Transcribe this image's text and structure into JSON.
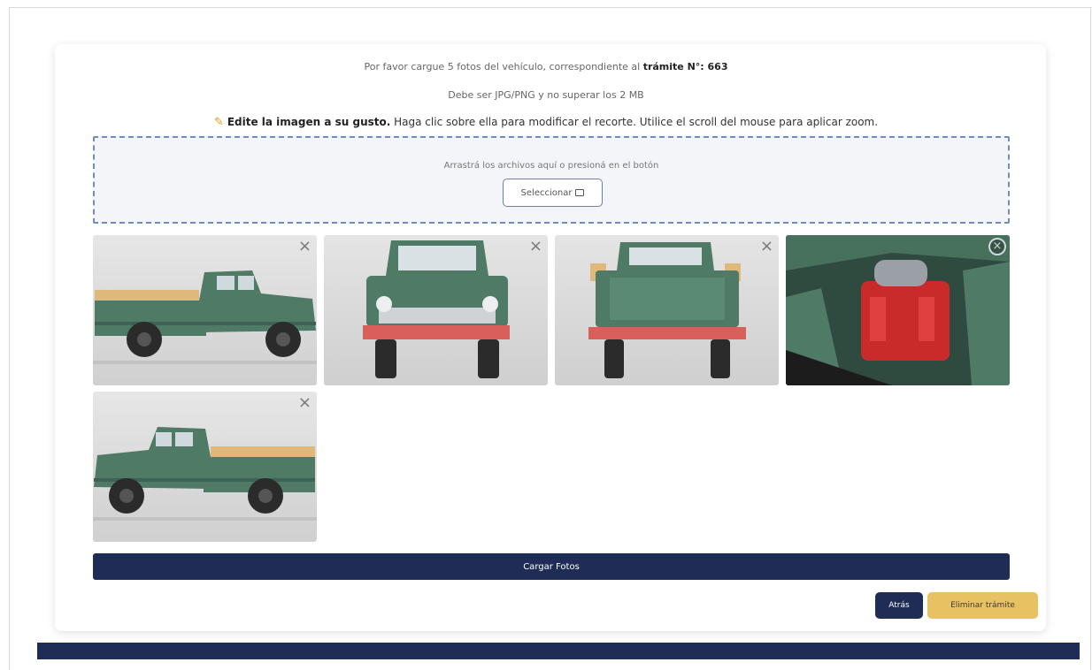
{
  "instructions": {
    "line1_prefix": "Por favor cargue 5 fotos del vehículo, correspondiente al",
    "line1_bold": "trámite N°: 663",
    "line2": "Debe ser JPG/PNG y no superar los 2 MB",
    "line3_bold": "Edite la imagen a su gusto.",
    "line3_rest": "Haga clic sobre ella para modificar el recorte. Utilice el scroll del mouse para aplicar zoom."
  },
  "dropzone": {
    "text": "Arrastrá los archivos aquí o presioná en el botón",
    "button_label": "Seleccionar",
    "button_icon": "folder-icon"
  },
  "photos": [
    {
      "name": "truck-side-left",
      "remove_icon": "close-icon"
    },
    {
      "name": "truck-front",
      "remove_icon": "close-icon"
    },
    {
      "name": "truck-rear",
      "remove_icon": "close-icon"
    },
    {
      "name": "truck-engine",
      "remove_icon": "close-circle-icon"
    },
    {
      "name": "truck-side-right",
      "remove_icon": "close-icon"
    }
  ],
  "actions": {
    "upload_label": "Cargar Fotos",
    "back_label": "Atrás",
    "delete_label": "Eliminar trámite"
  },
  "colors": {
    "primary": "#1f2c55",
    "warning": "#e8c262",
    "truck_green": "#4e7a66",
    "bumper_red": "#d9605a"
  }
}
